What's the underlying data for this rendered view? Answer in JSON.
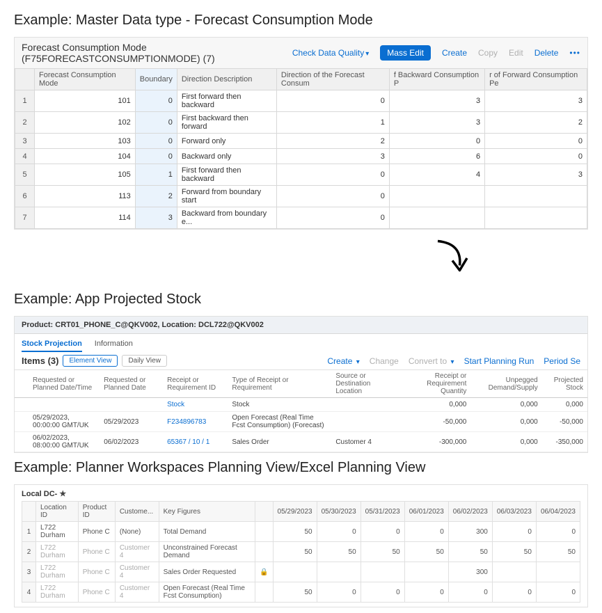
{
  "section1_title": "Example: Master Data type - Forecast Consumption Mode",
  "panel1": {
    "title": "Forecast Consumption Mode (F75FORECASTCONSUMPTIONMODE) (7)",
    "actions": {
      "check": "Check Data Quality",
      "mass_edit": "Mass Edit",
      "create": "Create",
      "copy": "Copy",
      "edit": "Edit",
      "delete": "Delete"
    },
    "headers": [
      "Forecast Consumption Mode",
      "Boundary",
      "Direction Description",
      "Direction of the Forecast Consum",
      "f Backward Consumption P",
      "r of Forward Consumption Pe"
    ],
    "rows": [
      {
        "n": "1",
        "mode": "101",
        "boundary": "0",
        "desc": "First forward then backward",
        "dir": "0",
        "back": "3",
        "fwd": "3"
      },
      {
        "n": "2",
        "mode": "102",
        "boundary": "0",
        "desc": "First backward then forward",
        "dir": "1",
        "back": "3",
        "fwd": "2"
      },
      {
        "n": "3",
        "mode": "103",
        "boundary": "0",
        "desc": "Forward only",
        "dir": "2",
        "back": "0",
        "fwd": "0"
      },
      {
        "n": "4",
        "mode": "104",
        "boundary": "0",
        "desc": "Backward only",
        "dir": "3",
        "back": "6",
        "fwd": "0"
      },
      {
        "n": "5",
        "mode": "105",
        "boundary": "1",
        "desc": "First forward then backward",
        "dir": "0",
        "back": "4",
        "fwd": "3"
      },
      {
        "n": "6",
        "mode": "113",
        "boundary": "2",
        "desc": "Forward from boundary start",
        "dir": "0",
        "back": "",
        "fwd": ""
      },
      {
        "n": "7",
        "mode": "114",
        "boundary": "3",
        "desc": "Backward from boundary e...",
        "dir": "0",
        "back": "",
        "fwd": ""
      }
    ]
  },
  "section2_title": "Example: App Projected Stock",
  "panel2": {
    "product_line": "Product: CRT01_PHONE_C@QKV002, Location: DCL722@QKV002",
    "tabs": {
      "stock": "Stock Projection",
      "info": "Information"
    },
    "items_label": "Items (3)",
    "views": {
      "element": "Element View",
      "daily": "Daily View"
    },
    "actions": {
      "create": "Create",
      "change": "Change",
      "convert": "Convert to",
      "start": "Start Planning Run",
      "period": "Period Se"
    },
    "headers": [
      "Requested or Planned Date/Time",
      "Requested or Planned Date",
      "Receipt or Requirement ID",
      "Type of Receipt or Requirement",
      "Source or Destination Location",
      "Receipt or Requirement Quantity",
      "Unpegged Demand/Supply",
      "Projected Stock"
    ],
    "rows": [
      {
        "dt": "",
        "date": "",
        "rid": "Stock",
        "type": "Stock",
        "loc": "",
        "qty": "0,000",
        "unp": "0,000",
        "proj": "0,000",
        "link": true,
        "neg": false
      },
      {
        "dt": "05/29/2023, 00:00:00 GMT/UK",
        "date": "05/29/2023",
        "rid": "F234896783",
        "type": "Open Forecast (Real Time Fcst Consumption) (Forecast)",
        "loc": "",
        "qty": "-50,000",
        "unp": "0,000",
        "proj": "-50,000",
        "link": true,
        "neg": true
      },
      {
        "dt": "06/02/2023, 08:00:00 GMT/UK",
        "date": "06/02/2023",
        "rid": "65367 / 10 / 1",
        "type": "Sales Order",
        "loc": "Customer 4",
        "qty": "-300,000",
        "unp": "0,000",
        "proj": "-350,000",
        "link": true,
        "neg": true
      }
    ]
  },
  "section3_title": "Example: Planner Workspaces Planning View/Excel Planning View",
  "panel3": {
    "title": "Local DC-",
    "headers": [
      "Location ID",
      "Product ID",
      "Custome...",
      "Key Figures",
      "",
      "05/29/2023",
      "05/30/2023",
      "05/31/2023",
      "06/01/2023",
      "06/02/2023",
      "06/03/2023",
      "06/04/2023"
    ],
    "rows": [
      {
        "n": "1",
        "loc": "L722 Durham",
        "prod": "Phone C",
        "cust": "(None)",
        "kf": "Total Demand",
        "lock": "",
        "v": [
          "50",
          "0",
          "0",
          "0",
          "300",
          "0",
          "0"
        ],
        "dim": false
      },
      {
        "n": "2",
        "loc": "L722 Durham",
        "prod": "Phone C",
        "cust": "Customer 4",
        "kf": "Unconstrained Forecast Demand",
        "lock": "",
        "v": [
          "50",
          "50",
          "50",
          "50",
          "50",
          "50",
          "50"
        ],
        "dim": true
      },
      {
        "n": "3",
        "loc": "L722 Durham",
        "prod": "Phone C",
        "cust": "Customer 4",
        "kf": "Sales Order Requested",
        "lock": "🔒",
        "v": [
          "",
          "",
          "",
          "",
          "300",
          "",
          ""
        ],
        "dim": true
      },
      {
        "n": "4",
        "loc": "L722 Durham",
        "prod": "Phone C",
        "cust": "Customer 4",
        "kf": "Open Forecast (Real Time Fcst Consumption)",
        "lock": "",
        "v": [
          "50",
          "0",
          "0",
          "0",
          "0",
          "0",
          "0"
        ],
        "dim": true
      }
    ]
  }
}
